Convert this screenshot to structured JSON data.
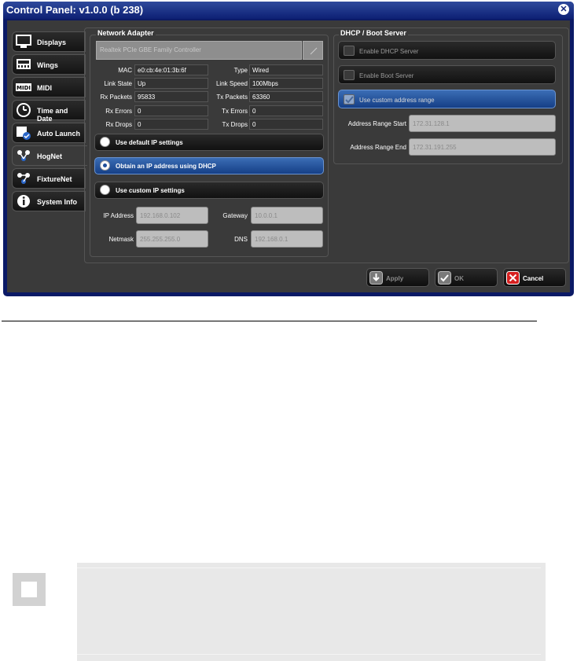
{
  "window": {
    "title": "Control Panel: v1.0.0 (b 238)"
  },
  "tabs": [
    {
      "label": "Displays",
      "icon": "monitor-icon"
    },
    {
      "label": "Wings",
      "icon": "wing-icon"
    },
    {
      "label": "MIDI",
      "icon": "midi-icon"
    },
    {
      "label": "Time and Date",
      "icon": "clock-icon"
    },
    {
      "label": "Auto Launch",
      "icon": "auto-launch-icon"
    },
    {
      "label": "HogNet",
      "icon": "network-icon"
    },
    {
      "label": "FixtureNet",
      "icon": "fixturenet-icon"
    },
    {
      "label": "System Info",
      "icon": "info-icon"
    }
  ],
  "network_adapter": {
    "title": "Network Adapter",
    "adapter": "Realtek PCIe GBE Family Controller",
    "mac_label": "MAC",
    "mac": "e0:cb:4e:01:3b:6f",
    "type_label": "Type",
    "type": "Wired",
    "link_state_label": "Link State",
    "link_state": "Up",
    "link_speed_label": "Link Speed",
    "link_speed": "100Mbps",
    "rx_packets_label": "Rx Packets",
    "rx_packets": "95833",
    "tx_packets_label": "Tx Packets",
    "tx_packets": "63360",
    "rx_errors_label": "Rx Errors",
    "rx_errors": "0",
    "tx_errors_label": "Tx Errors",
    "tx_errors": "0",
    "rx_drops_label": "Rx Drops",
    "rx_drops": "0",
    "tx_drops_label": "Tx Drops",
    "tx_drops": "0",
    "options": [
      "Use default IP settings",
      "Obtain an IP address using DHCP",
      "Use custom IP settings"
    ],
    "selected_option": 1,
    "ip_label": "IP Address",
    "ip": "192.168.0.102",
    "gateway_label": "Gateway",
    "gateway": "10.0.0.1",
    "netmask_label": "Netmask",
    "netmask": "255.255.255.0",
    "dns_label": "DNS",
    "dns": "192.168.0.1"
  },
  "dhcp": {
    "title": "DHCP / Boot Server",
    "enable_dhcp": "Enable DHCP Server",
    "enable_boot": "Enable Boot Server",
    "custom_range": "Use custom address range",
    "range_start_label": "Address Range Start",
    "range_start": "172.31.128.1",
    "range_end_label": "Address Range End",
    "range_end": "172.31.191.255"
  },
  "buttons": {
    "apply": "Apply",
    "ok": "OK",
    "cancel": "Cancel"
  },
  "colors": {
    "window_blue": "#0b1a66",
    "selected_blue": "#1f4f9a",
    "cancel_red": "#d62020"
  }
}
